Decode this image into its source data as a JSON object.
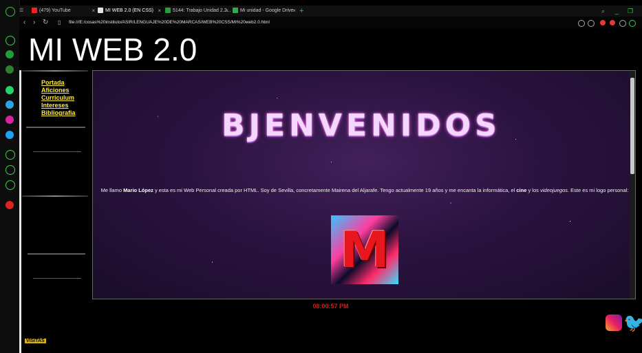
{
  "browser": {
    "tabs": [
      {
        "label": "(479) YouTube",
        "favicon_color": "#ff1e1e"
      },
      {
        "label": "MI WEB 2.0 (EN CSS)",
        "favicon_color": "#e5e5e5"
      },
      {
        "label": "5144: Trabajo Unidad 2.2...",
        "favicon_color": "#2a9d40"
      },
      {
        "label": "Mi unidad - Google Drive",
        "favicon_color": "#34a853"
      }
    ],
    "new_tab_icon": "plus-icon",
    "url": "file:///E:/cosas%20instituto/ASIR/LENGUAJE%20DE%20MARCAS/WEB%20CSS/MI%20web2.0.html"
  },
  "page": {
    "title": "MI WEB 2.0",
    "menu": [
      "Portada",
      "Aficiones",
      "Curriculum",
      "Intereses",
      "Bibliografia"
    ],
    "welcome": "BJENVENIDOS",
    "intro": {
      "pre": "Me llamo ",
      "name": "Mario López",
      "mid": " y esta es mi Web Personal creada por HTML. Soy de Sevilla, concretamente Mairena del Aljarafe. Tengo actualmente 19 años y me encanta la informática, el ",
      "cine": "cine",
      "and": " y los ",
      "games": "videojuegos",
      "end": ". Este es mi logo personal:"
    },
    "logo_letter": "M",
    "clock": "08:00:57 PM",
    "badge": "VISITAS"
  },
  "colors": {
    "menu_link": "#ffeb3b",
    "clock": "#c9201e",
    "accent_green": "#36c24a"
  }
}
